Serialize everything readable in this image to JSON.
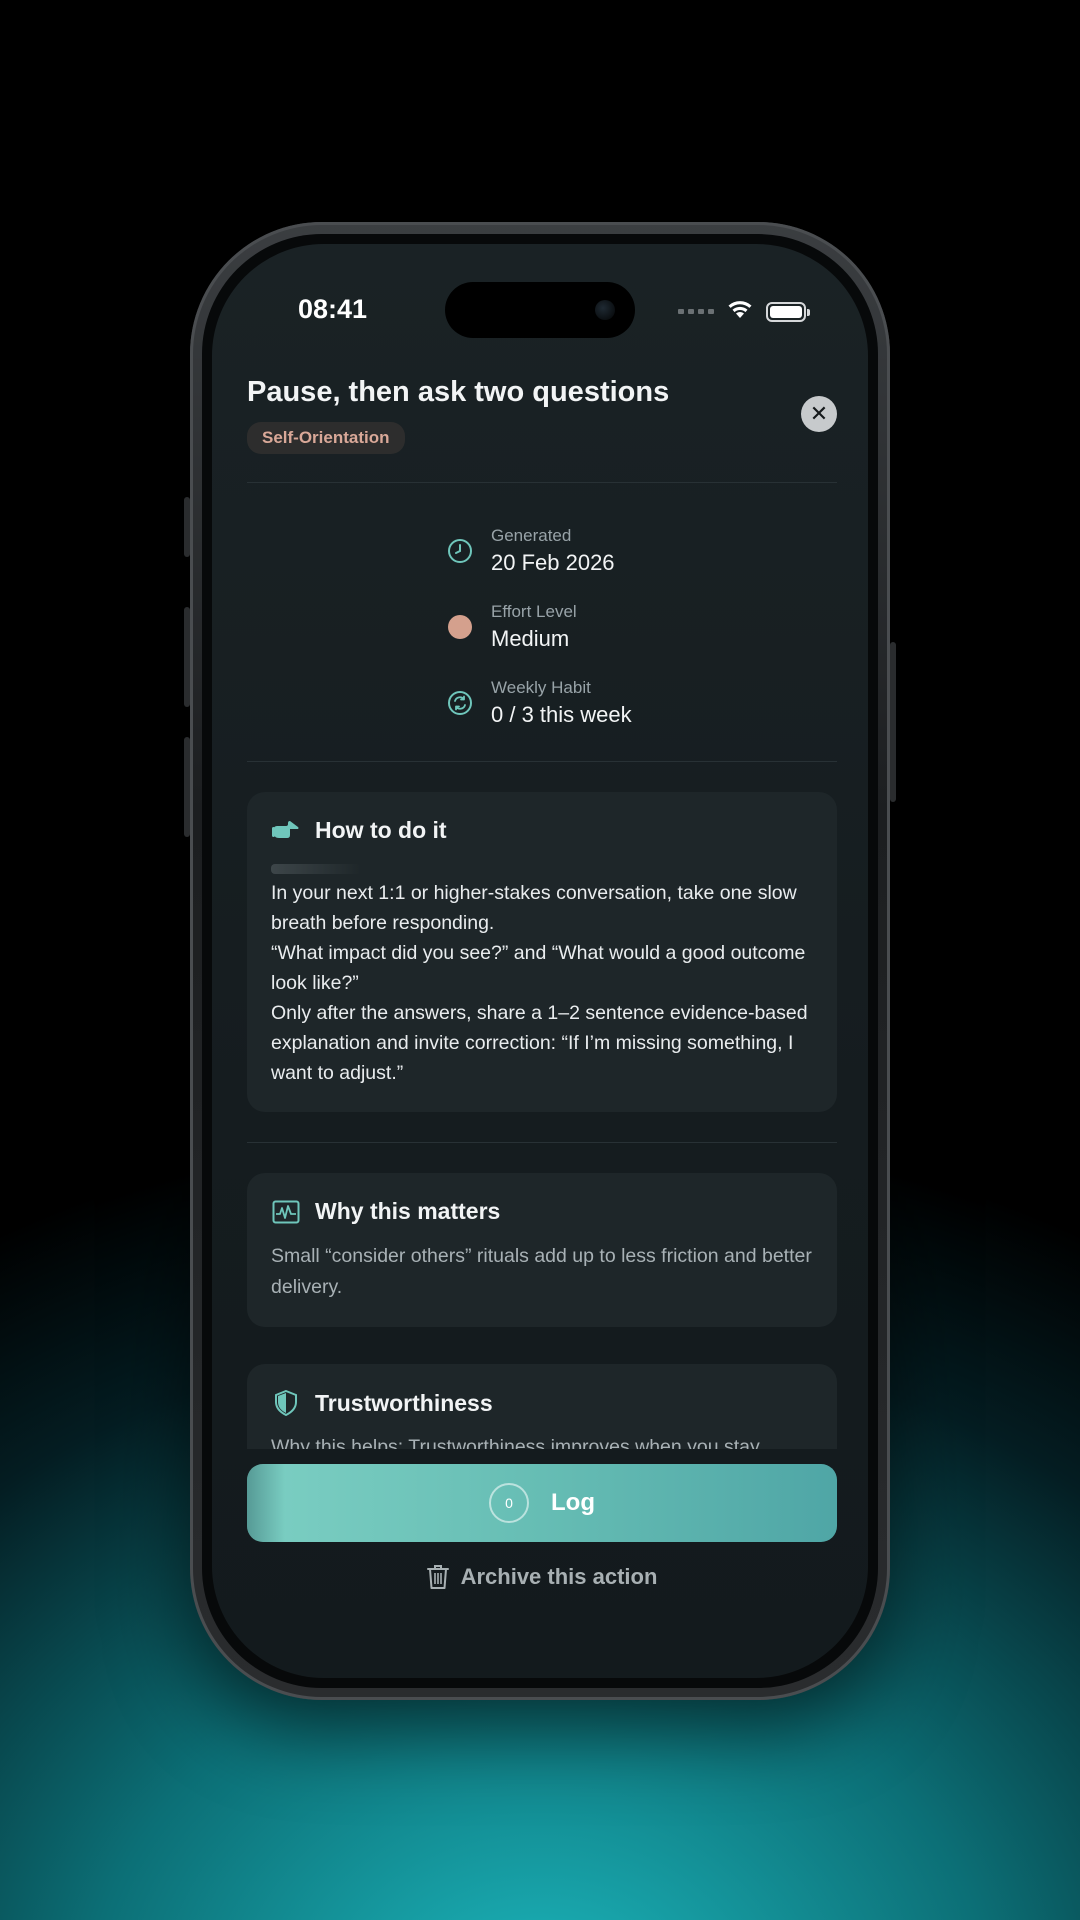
{
  "status_bar": {
    "time": "08:41"
  },
  "header": {
    "title": "Pause, then ask two questions",
    "tag": "Self-Orientation",
    "close_glyph": "✕"
  },
  "meta": [
    {
      "icon": "clock-icon",
      "label": "Generated",
      "value": "20 Feb 2026"
    },
    {
      "icon": "effort-dot-icon",
      "label": "Effort Level",
      "value": "Medium"
    },
    {
      "icon": "repeat-icon",
      "label": "Weekly Habit",
      "value": "0 / 3 this week"
    }
  ],
  "how_card": {
    "icon": "pointing-hand-icon",
    "title": "How to do it",
    "body": [
      "In your next 1:1 or higher-stakes conversation, take one slow breath before responding.",
      "“What impact did you see?” and “What would a good outcome look like?”",
      "Only after the answers, share a 1–2 sentence evidence-based explanation and invite correction: “If I’m missing something, I want to adjust.”"
    ]
  },
  "why_card": {
    "icon": "pulse-chart-icon",
    "title": "Why this matters",
    "body": "Small “consider others” rituals add up to less friction and better delivery."
  },
  "trust_card": {
    "icon": "shield-icon",
    "title": "Trustworthiness",
    "body": "Why this helps: Trustworthiness improves when you stay"
  },
  "log_button": {
    "count": "0",
    "label": "Log"
  },
  "archive": {
    "label": "Archive this action"
  },
  "colors": {
    "accent": "#6fc6bb",
    "tag_text": "#d9a898",
    "effort_dot": "#d4a08d"
  }
}
